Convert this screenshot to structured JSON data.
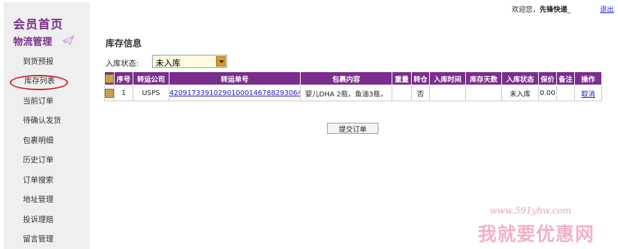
{
  "header": {
    "welcome_prefix": "欢迎您，",
    "username": "先锋快递",
    "suffix": "_",
    "logout_label": "退出"
  },
  "sidebar": {
    "brand": "会员首页",
    "section": "物流管理",
    "items": [
      {
        "label": "到货预报"
      },
      {
        "label": "库存列表"
      },
      {
        "label": "当前订单"
      },
      {
        "label": "待确认发货"
      },
      {
        "label": "包裹明细"
      },
      {
        "label": "历史订单"
      },
      {
        "label": "订单搜索"
      },
      {
        "label": "地址管理"
      },
      {
        "label": "投诉理赔"
      },
      {
        "label": "留言管理"
      }
    ],
    "active_index": 1
  },
  "main": {
    "title": "库存信息",
    "status_label": "入库状态:",
    "status_value": "未入库",
    "table": {
      "headers": [
        "",
        "序号",
        "转运公司",
        "转运单号",
        "包裹内容",
        "重量",
        "转仓",
        "入库时间",
        "库存天数",
        "入库状态",
        "保价",
        "备注",
        "操作"
      ],
      "rows": [
        {
          "index": "1",
          "carrier": "USPS",
          "tracking": "420917339102901000146788293064",
          "contents": "婴儿DHA 2瓶，鱼油3瓶，",
          "weight": "",
          "transfer": "否",
          "in_time": "",
          "days": "",
          "status": "未入库",
          "insurance": "0.00",
          "note": "",
          "action": "取消"
        }
      ]
    },
    "submit_label": "提交订单"
  },
  "watermark": {
    "url": "www.591yhw.com",
    "text": "我就要优惠网"
  }
}
